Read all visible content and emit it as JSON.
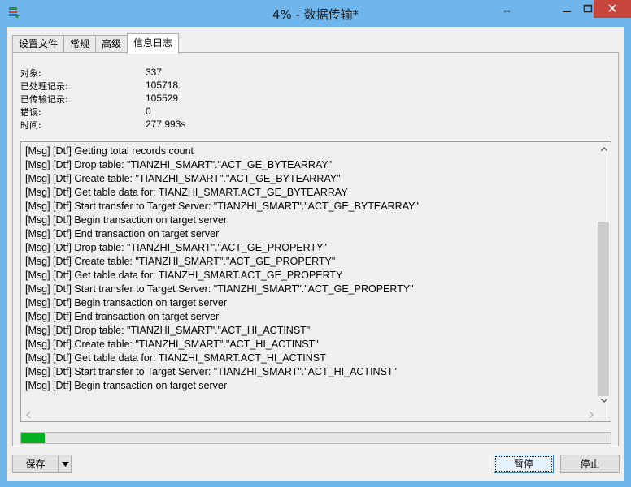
{
  "window": {
    "title": "4% - 数据传输*",
    "resize_indicator": "↔",
    "minimize_icon": "minimize-icon",
    "maximize_icon": "maximize-icon",
    "close_label": "✕"
  },
  "tabs": [
    {
      "label": "设置文件",
      "active": false
    },
    {
      "label": "常规",
      "active": false
    },
    {
      "label": "高级",
      "active": false
    },
    {
      "label": "信息日志",
      "active": true
    }
  ],
  "stats": [
    {
      "label": "对象:",
      "value": "337"
    },
    {
      "label": "已处理记录:",
      "value": "105718"
    },
    {
      "label": "已传输记录:",
      "value": "105529"
    },
    {
      "label": "错误:",
      "value": "0"
    },
    {
      "label": "时间:",
      "value": "277.993s"
    }
  ],
  "log": [
    "[Msg] [Dtf] Getting total records count",
    "[Msg] [Dtf] Drop table: \"TIANZHI_SMART\".\"ACT_GE_BYTEARRAY\"",
    "[Msg] [Dtf] Create table: \"TIANZHI_SMART\".\"ACT_GE_BYTEARRAY\"",
    "[Msg] [Dtf] Get table data for: TIANZHI_SMART.ACT_GE_BYTEARRAY",
    "[Msg] [Dtf] Start transfer to Target Server: \"TIANZHI_SMART\".\"ACT_GE_BYTEARRAY\"",
    "[Msg] [Dtf] Begin transaction on target server",
    "[Msg] [Dtf] End transaction on target server",
    "[Msg] [Dtf] Drop table: \"TIANZHI_SMART\".\"ACT_GE_PROPERTY\"",
    "[Msg] [Dtf] Create table: \"TIANZHI_SMART\".\"ACT_GE_PROPERTY\"",
    "[Msg] [Dtf] Get table data for: TIANZHI_SMART.ACT_GE_PROPERTY",
    "[Msg] [Dtf] Start transfer to Target Server: \"TIANZHI_SMART\".\"ACT_GE_PROPERTY\"",
    "[Msg] [Dtf] Begin transaction on target server",
    "[Msg] [Dtf] End transaction on target server",
    "[Msg] [Dtf] Drop table: \"TIANZHI_SMART\".\"ACT_HI_ACTINST\"",
    "[Msg] [Dtf] Create table: \"TIANZHI_SMART\".\"ACT_HI_ACTINST\"",
    "[Msg] [Dtf] Get table data for: TIANZHI_SMART.ACT_HI_ACTINST",
    "[Msg] [Dtf] Start transfer to Target Server: \"TIANZHI_SMART\".\"ACT_HI_ACTINST\"",
    "[Msg] [Dtf] Begin transaction on target server"
  ],
  "progress": {
    "percent": 4,
    "fill_color": "#06b025"
  },
  "buttons": {
    "save_label": "保存",
    "pause_label": "暂停",
    "stop_label": "停止"
  },
  "colors": {
    "titlebar": "#6fb6ec",
    "close": "#c7463c"
  }
}
